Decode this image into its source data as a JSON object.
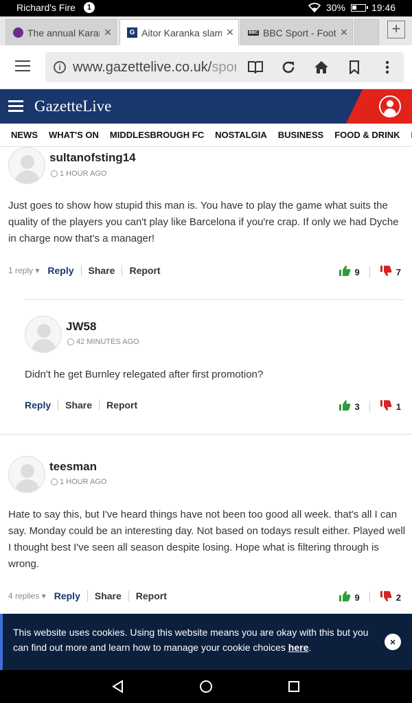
{
  "status_bar": {
    "carrier": "Richard's Fire",
    "notification_count": "1",
    "battery": "30%",
    "battery_level": 0.3,
    "time": "19:46"
  },
  "tabs": [
    {
      "title": "The annual Karanka",
      "active": false
    },
    {
      "title": "Aitor Karanka slams",
      "active": true
    },
    {
      "title": "BBC Sport - Football",
      "active": false
    }
  ],
  "new_tab_label": "+",
  "address_bar": {
    "url_main": "www.gazettelive.co.uk/",
    "url_dim": "sport"
  },
  "site": {
    "brand": "GazetteLive"
  },
  "nav": [
    "NEWS",
    "WHAT'S ON",
    "MIDDLESBROUGH FC",
    "NOSTALGIA",
    "BUSINESS",
    "FOOD & DRINK",
    "IN"
  ],
  "comments": [
    {
      "user": "sultanofsting14",
      "time": "1 HOUR AGO",
      "text": "Just goes to show how stupid this man is. You have to play the game what suits the quality of the players you can't play like Barcelona if you're crap. If only we had Dyche in charge now that's a manager!",
      "replies_label": "1 reply",
      "reply": "Reply",
      "share": "Share",
      "report": "Report",
      "up": "9",
      "down": "7"
    },
    {
      "user": "JW58",
      "time": "42 MINUTES AGO",
      "text": "Didn't he get Burnley relegated after first promotion?",
      "replies_label": "",
      "reply": "Reply",
      "share": "Share",
      "report": "Report",
      "up": "3",
      "down": "1"
    },
    {
      "user": "teesman",
      "time": "1 HOUR AGO",
      "text": "Hate to say this, but I've heard things have not been too good all week. that's all I can say. Monday could be an interesting day. Not based on todays result either. Played well I thought best I've seen all season despite losing. Hope what is filtering through is wrong.",
      "replies_label": "4 replies",
      "reply": "Reply",
      "share": "Share",
      "report": "Report",
      "up": "9",
      "down": "2"
    }
  ],
  "cookie": {
    "text": "This website uses cookies. Using this website means you are okay with this but you can find out more and learn how to manage your cookie choices ",
    "link": "here",
    "after": ".",
    "close": "×"
  },
  "colors": {
    "brand_blue": "#19376d",
    "brand_red": "#e2231a",
    "upvote": "#2e9e3a",
    "downvote": "#d32525"
  }
}
